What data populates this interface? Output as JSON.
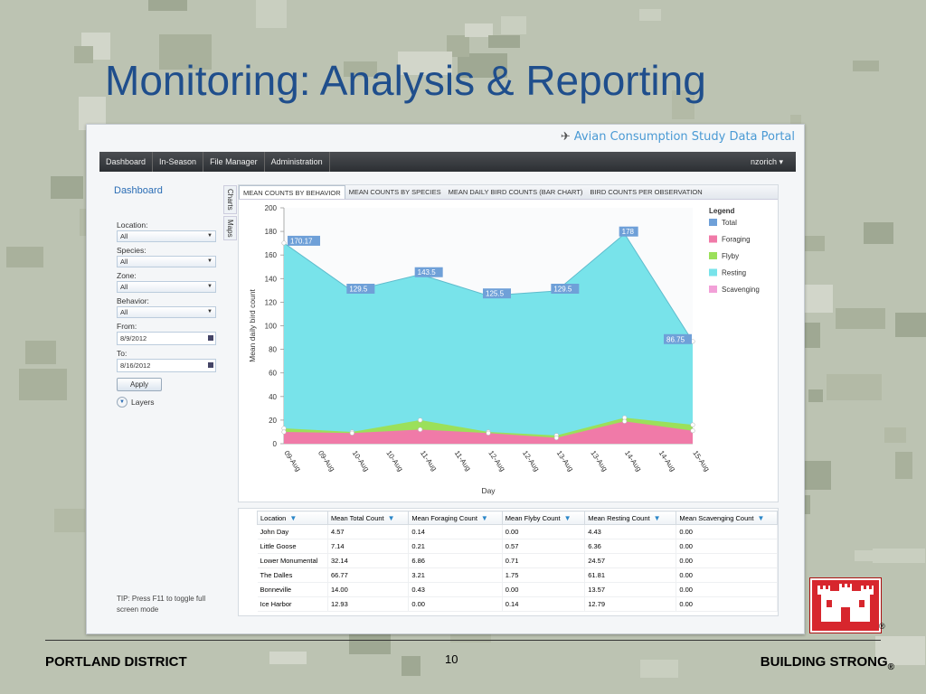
{
  "slide": {
    "title": "Monitoring: Analysis & Reporting",
    "footer_left": "PORTLAND DISTRICT",
    "page_number": "10",
    "footer_right": "BUILDING STRONG",
    "registered_mark": "®",
    "logo_icon": "castle-logo-icon"
  },
  "portal": {
    "title": "Avian Consumption Study Data Portal",
    "nav": [
      "Dashboard",
      "In-Season",
      "File Manager",
      "Administration"
    ],
    "user": "nzorich",
    "page_title": "Dashboard",
    "side_tabs": [
      "Charts",
      "Maps"
    ]
  },
  "filters": {
    "location_label": "Location:",
    "location_value": "All",
    "species_label": "Species:",
    "species_value": "All",
    "zone_label": "Zone:",
    "zone_value": "All",
    "behavior_label": "Behavior:",
    "behavior_value": "All",
    "from_label": "From:",
    "from_value": "8/9/2012",
    "to_label": "To:",
    "to_value": "8/16/2012",
    "apply": "Apply",
    "layers": "Layers",
    "tip": "TIP: Press F11 to toggle full screen mode"
  },
  "chart_tabs": [
    "MEAN COUNTS BY BEHAVIOR",
    "MEAN COUNTS BY SPECIES",
    "MEAN DAILY BIRD COUNTS (BAR CHART)",
    "BIRD COUNTS PER OBSERVATION"
  ],
  "chart_data": {
    "type": "area",
    "xlabel": "Day",
    "ylabel": "Mean daily bird count",
    "ylim": [
      0,
      200
    ],
    "yticks": [
      0,
      20,
      40,
      60,
      80,
      100,
      120,
      140,
      160,
      180,
      200
    ],
    "categories": [
      "09-Aug",
      "09-Aug",
      "10-Aug",
      "10-Aug",
      "11-Aug",
      "11-Aug",
      "12-Aug",
      "12-Aug",
      "13-Aug",
      "13-Aug",
      "14-Aug",
      "14-Aug",
      "15-Aug"
    ],
    "legend_title": "Legend",
    "series": [
      {
        "name": "Total",
        "color": "#6fa0d8",
        "values": [
          170.17,
          129.5,
          143.5,
          125.5,
          129.5,
          178,
          86.75
        ]
      },
      {
        "name": "Foraging",
        "color": "#f07aa8",
        "values": [
          10,
          9,
          12,
          9,
          5,
          19,
          11
        ]
      },
      {
        "name": "Flyby",
        "color": "#9be05a",
        "values": [
          13,
          10,
          20,
          10,
          7,
          22,
          16
        ]
      },
      {
        "name": "Resting",
        "color": "#78e3ea",
        "values": [
          170.17,
          129.5,
          143.5,
          125.5,
          129.5,
          178,
          86.75
        ]
      },
      {
        "name": "Scavenging",
        "color": "#f2a0d8",
        "values": [
          0,
          0,
          0,
          0,
          0,
          0,
          0
        ]
      }
    ],
    "data_labels": [
      "170.17",
      "129.5",
      "143.5",
      "125.5",
      "129.5",
      "178",
      "86.75"
    ]
  },
  "grid": {
    "columns": [
      "Location",
      "Mean Total Count",
      "Mean Foraging Count",
      "Mean Flyby Count",
      "Mean Resting Count",
      "Mean Scavenging Count"
    ],
    "rows": [
      [
        "John Day",
        "4.57",
        "0.14",
        "0.00",
        "4.43",
        "0.00"
      ],
      [
        "Little Goose",
        "7.14",
        "0.21",
        "0.57",
        "6.36",
        "0.00"
      ],
      [
        "Lower Monumental",
        "32.14",
        "6.86",
        "0.71",
        "24.57",
        "0.00"
      ],
      [
        "The Dalles",
        "66.77",
        "3.21",
        "1.75",
        "61.81",
        "0.00"
      ],
      [
        "Bonneville",
        "14.00",
        "0.43",
        "0.00",
        "13.57",
        "0.00"
      ],
      [
        "Ice Harbor",
        "12.93",
        "0.00",
        "0.14",
        "12.79",
        "0.00"
      ]
    ]
  }
}
